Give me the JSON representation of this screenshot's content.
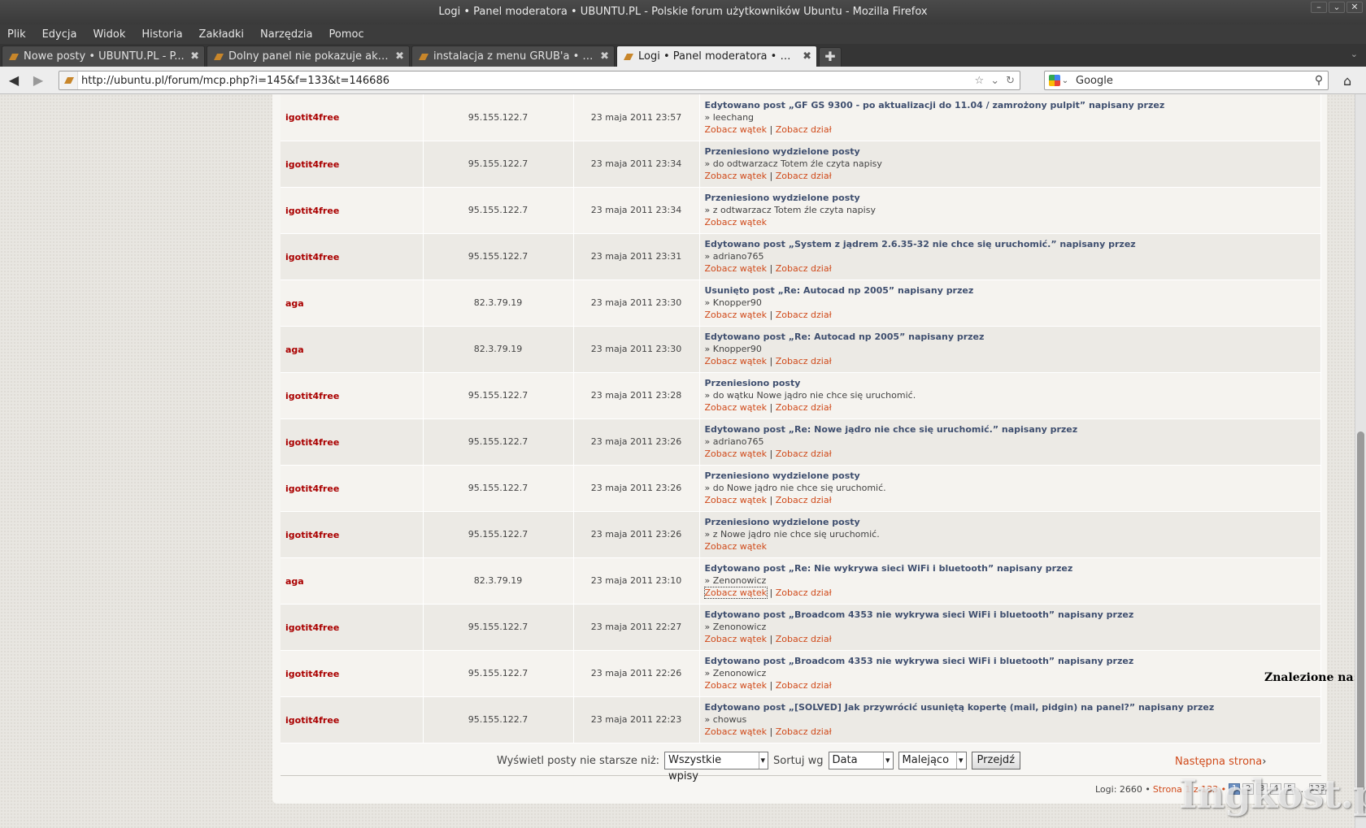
{
  "window": {
    "title": "Logi • Panel moderatora • UBUNTU.PL - Polskie forum użytkowników Ubuntu - Mozilla Firefox"
  },
  "menu": [
    {
      "label": "Plik"
    },
    {
      "label": "Edycja"
    },
    {
      "label": "Widok"
    },
    {
      "label": "Historia"
    },
    {
      "label": "Zakładki"
    },
    {
      "label": "Narzędzia"
    },
    {
      "label": "Pomoc"
    }
  ],
  "tabs": [
    {
      "label": "Nowe posty • UBUNTU.PL - P..."
    },
    {
      "label": "Dolny panel nie pokazuje aktua..."
    },
    {
      "label": "instalacja z menu GRUB'a • UB..."
    },
    {
      "label": "Logi • Panel moderatora • UBU..."
    }
  ],
  "nav": {
    "url": "http://ubuntu.pl/forum/mcp.php?i=145&f=133&t=146686",
    "search_engine": "Google"
  },
  "links": {
    "topic": "Zobacz wątek",
    "forum": "Zobacz dział",
    "sep": " | "
  },
  "logs": [
    {
      "user": "igotit4free",
      "ip": "95.155.122.7",
      "date": "23 maja 2011 23:57",
      "action": "Edytowano post „GF GS 9300 - po aktualizacji do 11.04 / zamrożony pulpit” napisany przez",
      "detail": "» leechang",
      "forum_link": true
    },
    {
      "user": "igotit4free",
      "ip": "95.155.122.7",
      "date": "23 maja 2011 23:34",
      "action": "Przeniesiono wydzielone posty",
      "detail": "» do odtwarzacz Totem źle czyta napisy",
      "forum_link": true
    },
    {
      "user": "igotit4free",
      "ip": "95.155.122.7",
      "date": "23 maja 2011 23:34",
      "action": "Przeniesiono wydzielone posty",
      "detail": "» z odtwarzacz Totem źle czyta napisy",
      "forum_link": false
    },
    {
      "user": "igotit4free",
      "ip": "95.155.122.7",
      "date": "23 maja 2011 23:31",
      "action": "Edytowano post „System z jądrem 2.6.35-32 nie chce się uruchomić.” napisany przez",
      "detail": "» adriano765",
      "forum_link": true
    },
    {
      "user": "aga",
      "ip": "82.3.79.19",
      "date": "23 maja 2011 23:30",
      "action": "Usunięto post „Re: Autocad np 2005” napisany przez",
      "detail": "» Knopper90",
      "forum_link": true
    },
    {
      "user": "aga",
      "ip": "82.3.79.19",
      "date": "23 maja 2011 23:30",
      "action": "Edytowano post „Re: Autocad np 2005” napisany przez",
      "detail": "» Knopper90",
      "forum_link": true
    },
    {
      "user": "igotit4free",
      "ip": "95.155.122.7",
      "date": "23 maja 2011 23:28",
      "action": "Przeniesiono posty",
      "detail": "» do wątku Nowe jądro nie chce się uruchomić.",
      "forum_link": true
    },
    {
      "user": "igotit4free",
      "ip": "95.155.122.7",
      "date": "23 maja 2011 23:26",
      "action": "Edytowano post „Re: Nowe jądro nie chce się uruchomić.” napisany przez",
      "detail": "» adriano765",
      "forum_link": true
    },
    {
      "user": "igotit4free",
      "ip": "95.155.122.7",
      "date": "23 maja 2011 23:26",
      "action": "Przeniesiono wydzielone posty",
      "detail": "» do Nowe jądro nie chce się uruchomić.",
      "forum_link": true
    },
    {
      "user": "igotit4free",
      "ip": "95.155.122.7",
      "date": "23 maja 2011 23:26",
      "action": "Przeniesiono wydzielone posty",
      "detail": "» z Nowe jądro nie chce się uruchomić.",
      "forum_link": false
    },
    {
      "user": "aga",
      "ip": "82.3.79.19",
      "date": "23 maja 2011 23:10",
      "action": "Edytowano post „Re: Nie wykrywa sieci WiFi i bluetooth” napisany przez",
      "detail": "» Zenonowicz",
      "forum_link": true,
      "focused": true
    },
    {
      "user": "igotit4free",
      "ip": "95.155.122.7",
      "date": "23 maja 2011 22:27",
      "action": "Edytowano post „Broadcom 4353 nie wykrywa sieci WiFi i bluetooth” napisany przez",
      "detail": "» Zenonowicz",
      "forum_link": true
    },
    {
      "user": "igotit4free",
      "ip": "95.155.122.7",
      "date": "23 maja 2011 22:26",
      "action": "Edytowano post „Broadcom 4353 nie wykrywa sieci WiFi i bluetooth” napisany przez",
      "detail": "» Zenonowicz",
      "forum_link": true
    },
    {
      "user": "igotit4free",
      "ip": "95.155.122.7",
      "date": "23 maja 2011 22:23",
      "action": "Edytowano post „[SOLVED] Jak przywrócić usuniętą kopertę (mail, pidgin) na panel?” napisany przez",
      "detail": "» chowus",
      "forum_link": true
    }
  ],
  "filter": {
    "label": "Wyświetl posty nie starsze niż:",
    "age_value": "Wszystkie wpisy",
    "sort_label": "Sortuj wg",
    "sort_value": "Data",
    "order_value": "Malejąco",
    "go_label": "Przejdź",
    "next_label": "Następna strona",
    "next_arrow": "›"
  },
  "found_label": "Znalezione na:",
  "pagination": {
    "total": "Logi: 2660 •",
    "page_text": "Strona 1 z 133 •",
    "pages": [
      "1",
      "2",
      "3",
      "4",
      "5",
      "...",
      "133"
    ]
  },
  "watermark": "Ingkost.pl"
}
